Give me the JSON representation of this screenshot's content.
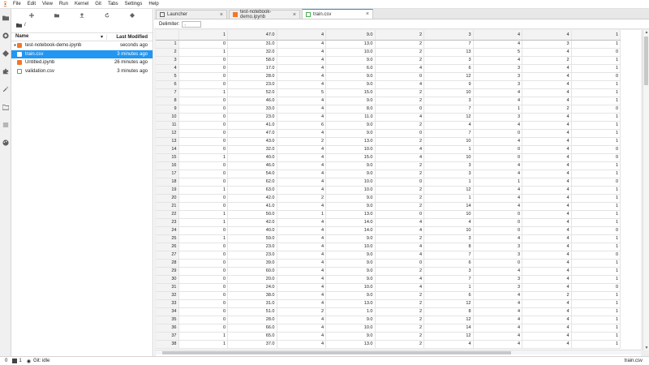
{
  "menubar": {
    "items": [
      "File",
      "Edit",
      "View",
      "Run",
      "Kernel",
      "Git",
      "Tabs",
      "Settings",
      "Help"
    ]
  },
  "sidebar": {
    "icons": [
      "folder-icon",
      "running-icon",
      "git-icon",
      "extension-icon",
      "wrench-icon",
      "folder-open-icon",
      "list-icon",
      "palette-icon"
    ]
  },
  "filebrowser": {
    "breadcrumb": "/",
    "columns": {
      "name": "Name",
      "modified": "Last Modified"
    },
    "files": [
      {
        "name": "test-notebook-demo.ipynb",
        "modified": "seconds ago",
        "type": "notebook",
        "running": true,
        "selected": false
      },
      {
        "name": "train.csv",
        "modified": "3 minutes ago",
        "type": "csv",
        "running": false,
        "selected": true
      },
      {
        "name": "Untitled.ipynb",
        "modified": "26 minutes ago",
        "type": "notebook",
        "running": false,
        "selected": false
      },
      {
        "name": "validation.csv",
        "modified": "3 minutes ago",
        "type": "csv",
        "running": false,
        "selected": false
      }
    ]
  },
  "tabs": [
    {
      "label": "Launcher",
      "icon": "launcher-icon",
      "active": false
    },
    {
      "label": "test-notebook-demo.ipynb",
      "icon": "notebook-icon",
      "active": false
    },
    {
      "label": "train.csv",
      "icon": "csv-icon",
      "active": true
    }
  ],
  "csv_viewer": {
    "delimiter_label": "Delimiter:",
    "delimiter_value": ",",
    "header": [
      "",
      "1",
      "47.0",
      "4",
      "9.0",
      "2",
      "3",
      "4",
      "4",
      "1"
    ],
    "rows": [
      [
        "1",
        "0",
        "31.0",
        "4",
        "13.0",
        "2",
        "7",
        "4",
        "3",
        "1"
      ],
      [
        "2",
        "1",
        "32.0",
        "4",
        "10.0",
        "2",
        "13",
        "5",
        "4",
        "0"
      ],
      [
        "3",
        "0",
        "58.0",
        "4",
        "9.0",
        "2",
        "3",
        "4",
        "2",
        "1"
      ],
      [
        "4",
        "0",
        "17.0",
        "4",
        "6.0",
        "4",
        "6",
        "3",
        "4",
        "1"
      ],
      [
        "5",
        "0",
        "28.0",
        "4",
        "9.0",
        "0",
        "12",
        "3",
        "4",
        "0"
      ],
      [
        "6",
        "0",
        "23.0",
        "4",
        "9.0",
        "4",
        "9",
        "3",
        "4",
        "1"
      ],
      [
        "7",
        "1",
        "52.0",
        "5",
        "15.0",
        "2",
        "10",
        "4",
        "4",
        "1"
      ],
      [
        "8",
        "0",
        "46.0",
        "4",
        "9.0",
        "2",
        "3",
        "4",
        "4",
        "1"
      ],
      [
        "9",
        "0",
        "33.0",
        "4",
        "8.0",
        "0",
        "7",
        "1",
        "2",
        "0"
      ],
      [
        "10",
        "0",
        "23.0",
        "4",
        "11.0",
        "4",
        "12",
        "3",
        "4",
        "1"
      ],
      [
        "11",
        "0",
        "41.0",
        "6",
        "9.0",
        "2",
        "4",
        "4",
        "4",
        "1"
      ],
      [
        "12",
        "0",
        "47.0",
        "4",
        "9.0",
        "0",
        "7",
        "0",
        "4",
        "1"
      ],
      [
        "13",
        "0",
        "43.0",
        "2",
        "13.0",
        "2",
        "10",
        "4",
        "4",
        "1"
      ],
      [
        "14",
        "0",
        "32.0",
        "4",
        "10.0",
        "4",
        "1",
        "0",
        "4",
        "0"
      ],
      [
        "15",
        "1",
        "40.0",
        "4",
        "15.0",
        "4",
        "10",
        "0",
        "4",
        "0"
      ],
      [
        "16",
        "0",
        "46.0",
        "4",
        "9.0",
        "2",
        "3",
        "4",
        "4",
        "1"
      ],
      [
        "17",
        "0",
        "54.0",
        "4",
        "9.0",
        "2",
        "3",
        "4",
        "4",
        "1"
      ],
      [
        "18",
        "0",
        "62.0",
        "4",
        "10.0",
        "0",
        "1",
        "1",
        "4",
        "0"
      ],
      [
        "19",
        "1",
        "63.0",
        "4",
        "10.0",
        "2",
        "12",
        "4",
        "4",
        "1"
      ],
      [
        "20",
        "0",
        "42.0",
        "2",
        "9.0",
        "2",
        "1",
        "4",
        "4",
        "1"
      ],
      [
        "21",
        "0",
        "41.0",
        "4",
        "9.0",
        "2",
        "14",
        "4",
        "4",
        "1"
      ],
      [
        "22",
        "1",
        "50.0",
        "1",
        "13.0",
        "0",
        "10",
        "0",
        "4",
        "1"
      ],
      [
        "23",
        "1",
        "42.0",
        "4",
        "14.0",
        "4",
        "4",
        "0",
        "4",
        "1"
      ],
      [
        "24",
        "0",
        "40.0",
        "4",
        "14.0",
        "4",
        "10",
        "0",
        "4",
        "0"
      ],
      [
        "25",
        "1",
        "59.0",
        "4",
        "9.0",
        "2",
        "3",
        "4",
        "4",
        "1"
      ],
      [
        "26",
        "0",
        "23.0",
        "4",
        "10.0",
        "4",
        "8",
        "3",
        "4",
        "1"
      ],
      [
        "27",
        "0",
        "23.0",
        "4",
        "9.0",
        "4",
        "7",
        "3",
        "4",
        "0"
      ],
      [
        "28",
        "0",
        "39.0",
        "4",
        "9.0",
        "0",
        "6",
        "0",
        "4",
        "1"
      ],
      [
        "29",
        "0",
        "60.0",
        "4",
        "9.0",
        "2",
        "3",
        "4",
        "4",
        "1"
      ],
      [
        "30",
        "0",
        "20.0",
        "4",
        "9.0",
        "4",
        "7",
        "3",
        "4",
        "1"
      ],
      [
        "31",
        "0",
        "24.0",
        "4",
        "10.0",
        "4",
        "1",
        "3",
        "4",
        "0"
      ],
      [
        "32",
        "0",
        "38.0",
        "4",
        "9.0",
        "2",
        "6",
        "4",
        "2",
        "1"
      ],
      [
        "33",
        "0",
        "31.0",
        "4",
        "13.0",
        "2",
        "12",
        "4",
        "4",
        "1"
      ],
      [
        "34",
        "0",
        "51.0",
        "2",
        "1.0",
        "2",
        "8",
        "4",
        "4",
        "1"
      ],
      [
        "35",
        "0",
        "28.0",
        "4",
        "9.0",
        "2",
        "12",
        "4",
        "4",
        "1"
      ],
      [
        "36",
        "0",
        "66.0",
        "4",
        "10.0",
        "2",
        "14",
        "4",
        "4",
        "1"
      ],
      [
        "37",
        "1",
        "65.0",
        "4",
        "9.0",
        "2",
        "12",
        "4",
        "4",
        "1"
      ],
      [
        "38",
        "1",
        "37.0",
        "4",
        "13.0",
        "2",
        "4",
        "4",
        "4",
        "1"
      ]
    ]
  },
  "statusbar": {
    "count1": "0",
    "count2": "1",
    "git_status": "Git: idle",
    "right_label": "train.csv"
  }
}
